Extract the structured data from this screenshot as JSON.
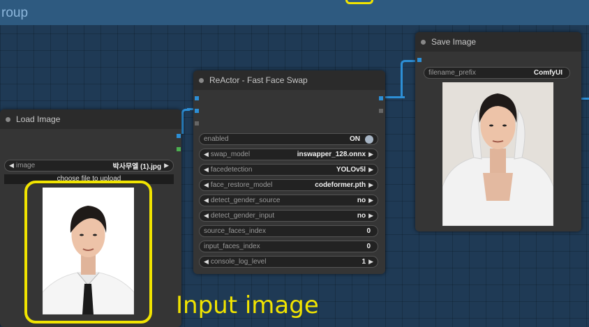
{
  "group": {
    "title": "roup"
  },
  "nodes": {
    "load_image": {
      "title": "Load Image",
      "image_widget": {
        "label": "image",
        "value": "박사무엘 (1).jpg"
      },
      "upload_button": "choose file to upload"
    },
    "reactor": {
      "title": "ReActor - Fast Face Swap",
      "widgets": [
        {
          "label": "enabled",
          "value": "ON",
          "kind": "toggle"
        },
        {
          "label": "swap_model",
          "value": "inswapper_128.onnx",
          "kind": "combo"
        },
        {
          "label": "facedetection",
          "value": "YOLOv5l",
          "kind": "combo"
        },
        {
          "label": "face_restore_model",
          "value": "codeformer.pth",
          "kind": "combo"
        },
        {
          "label": "detect_gender_source",
          "value": "no",
          "kind": "combo"
        },
        {
          "label": "detect_gender_input",
          "value": "no",
          "kind": "combo"
        },
        {
          "label": "source_faces_index",
          "value": "0",
          "kind": "text"
        },
        {
          "label": "input_faces_index",
          "value": "0",
          "kind": "text"
        },
        {
          "label": "console_log_level",
          "value": "1",
          "kind": "number"
        }
      ]
    },
    "save_image": {
      "title": "Save Image",
      "filename_widget": {
        "label": "filename_prefix",
        "value": "ComfyUI"
      }
    }
  },
  "annotation": "Input image",
  "colors": {
    "wire": "#2d8fd6",
    "highlight": "#f1e400",
    "canvas": "#1f3a55",
    "node": "#353535"
  },
  "icons": [
    "left-arrow-icon",
    "right-arrow-icon",
    "toggle-icon",
    "status-dot-icon"
  ]
}
